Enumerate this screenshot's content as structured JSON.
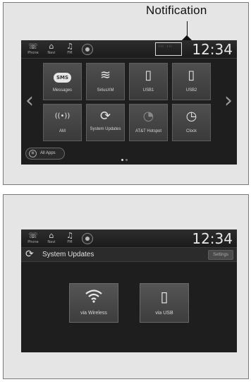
{
  "callout": {
    "label": "Notification"
  },
  "screen1": {
    "status_buttons": [
      {
        "glyph": "☏",
        "label": "Phone",
        "icon": "phone-icon"
      },
      {
        "glyph": "⌂",
        "label": "Navi",
        "icon": "navi-icon"
      },
      {
        "glyph": "♫",
        "label": "FM",
        "icon": "audio-icon"
      }
    ],
    "clock": "12:34",
    "notification_dots": "⁝⁝⁝ ⁝⁝⁝",
    "tiles": [
      {
        "glyph": "SMS",
        "label": "Messages",
        "icon": "sms-icon"
      },
      {
        "glyph": "≋",
        "label": "SiriusXM",
        "icon": "siriusxm-icon"
      },
      {
        "glyph": "▯",
        "label": "USB1",
        "icon": "usb-icon"
      },
      {
        "glyph": "▯",
        "label": "USB2",
        "icon": "usb-icon"
      },
      {
        "glyph": "((•))",
        "label": "AM",
        "icon": "radio-icon"
      },
      {
        "glyph": "⟳",
        "label": "System Updates",
        "icon": "sync-icon"
      },
      {
        "glyph": "◔",
        "label": "AT&T Hotspot",
        "icon": "hotspot-icon"
      },
      {
        "glyph": "◷",
        "label": "Clock",
        "icon": "clock-icon"
      }
    ],
    "left_arrow": "‹",
    "right_arrow": "›",
    "all_apps": "All Apps",
    "all_apps_glyph": "⊞",
    "pages": 2,
    "active_page": 1
  },
  "screen2": {
    "status_buttons": [
      {
        "glyph": "☏",
        "label": "Phone",
        "icon": "phone-icon"
      },
      {
        "glyph": "⌂",
        "label": "Navi",
        "icon": "navi-icon"
      },
      {
        "glyph": "♫",
        "label": "FM",
        "icon": "audio-icon"
      }
    ],
    "clock": "12:34",
    "title_glyph": "⟳",
    "title": "System Updates",
    "settings": "Settings",
    "options": [
      {
        "glyph": "◠",
        "label": "via Wireless",
        "icon": "wifi-icon"
      },
      {
        "glyph": "▯",
        "label": "via USB",
        "icon": "usb-icon"
      }
    ]
  }
}
